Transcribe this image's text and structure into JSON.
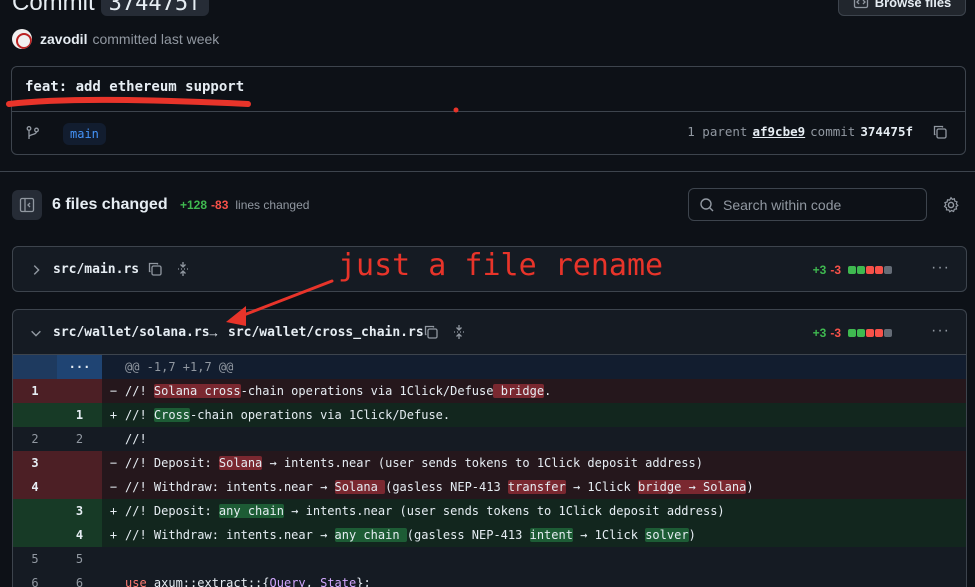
{
  "header": {
    "title": "Commit",
    "sha": "374475f",
    "browse_label": "Browse files"
  },
  "author": {
    "name": "zavodil",
    "meta": "committed last week"
  },
  "commit": {
    "message": "feat: add ethereum support",
    "branch": "main",
    "parents_label": "1 parent",
    "parent_sha": "af9cbe9",
    "commit_label": "commit",
    "commit_sha": "374475f"
  },
  "summary": {
    "files_changed": "6 files changed",
    "additions": "+128",
    "deletions": "-83",
    "lines_label": "lines changed",
    "search_placeholder": "Search within code"
  },
  "files": [
    {
      "path": "src/main.rs",
      "additions": "+3",
      "deletions": "-3"
    },
    {
      "old_path": "src/wallet/solana.rs",
      "arrow": "→",
      "path": "src/wallet/cross_chain.rs",
      "additions": "+3",
      "deletions": "-3"
    }
  ],
  "diff": {
    "hunk": "@@ -1,7 +1,7 @@",
    "expand": "···"
  },
  "annotation": {
    "text": "just a file rename",
    "color": "#e8342a"
  },
  "colors": {
    "background": "#0d1117",
    "addition": "#3fb950",
    "deletion": "#f85149",
    "link": "#4493f8"
  }
}
